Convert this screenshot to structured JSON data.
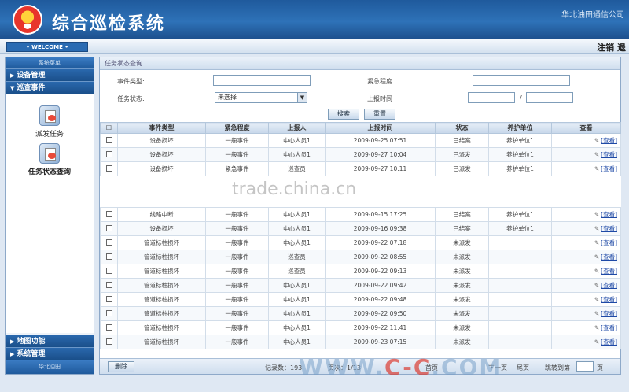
{
  "app": {
    "title": "综合巡检系统",
    "company": "华北油田通信公司",
    "welcome": "• WELCOME •",
    "logout": "注销 退"
  },
  "sidebar": {
    "head": "系统菜单",
    "items": [
      {
        "label": "设备管理"
      },
      {
        "label": "巡查事件"
      }
    ],
    "tasks": [
      {
        "label": "派发任务"
      },
      {
        "label": "任务状态查询"
      }
    ],
    "bottom_items": [
      {
        "label": "地图功能"
      },
      {
        "label": "系统管理"
      }
    ],
    "footer": "华北油田"
  },
  "main": {
    "panel_title": "任务状态查询",
    "filter": {
      "event_type_label": "事件类型:",
      "urgency_label": "紧急程度",
      "status_label": "任务状态:",
      "status_value": "未选择",
      "report_time_label": "上报时间",
      "date_sep": "/",
      "search_button": "搜索",
      "reset_button": "重置"
    },
    "columns": [
      "",
      "事件类型",
      "紧急程度",
      "上报人",
      "上报时间",
      "状态",
      "养护单位",
      "查看"
    ],
    "rows_top": [
      {
        "type": "设备损坏",
        "urgency": "一般事件",
        "reporter": "中心人员1",
        "time": "2009-09-25 07:51",
        "status": "已结案",
        "unit": "养护单位1",
        "view": "[查看]"
      },
      {
        "type": "设备损坏",
        "urgency": "一般事件",
        "reporter": "中心人员1",
        "time": "2009-09-27 10:04",
        "status": "已派发",
        "unit": "养护单位1",
        "view": "[查看]"
      },
      {
        "type": "设备损坏",
        "urgency": "紧急事件",
        "reporter": "巡查员",
        "time": "2009-09-27 10:11",
        "status": "已派发",
        "unit": "养护单位1",
        "view": "[查看]"
      }
    ],
    "rows_bottom": [
      {
        "type": "线路中断",
        "urgency": "一般事件",
        "reporter": "中心人员1",
        "time": "2009-09-15 17:25",
        "status": "已结案",
        "unit": "养护单位1",
        "view": "[查看]"
      },
      {
        "type": "设备损坏",
        "urgency": "一般事件",
        "reporter": "中心人员1",
        "time": "2009-09-16 09:38",
        "status": "已结案",
        "unit": "养护单位1",
        "view": "[查看]"
      },
      {
        "type": "管道标桩损坏",
        "urgency": "一般事件",
        "reporter": "中心人员1",
        "time": "2009-09-22 07:18",
        "status": "未派发",
        "unit": "",
        "view": "[查看]"
      },
      {
        "type": "管道标桩损坏",
        "urgency": "一般事件",
        "reporter": "巡查员",
        "time": "2009-09-22 08:55",
        "status": "未派发",
        "unit": "",
        "view": "[查看]"
      },
      {
        "type": "管道标桩损坏",
        "urgency": "一般事件",
        "reporter": "巡查员",
        "time": "2009-09-22 09:13",
        "status": "未派发",
        "unit": "",
        "view": "[查看]"
      },
      {
        "type": "管道标桩损坏",
        "urgency": "一般事件",
        "reporter": "中心人员1",
        "time": "2009-09-22 09:42",
        "status": "未派发",
        "unit": "",
        "view": "[查看]"
      },
      {
        "type": "管道标桩损坏",
        "urgency": "一般事件",
        "reporter": "中心人员1",
        "time": "2009-09-22 09:48",
        "status": "未派发",
        "unit": "",
        "view": "[查看]"
      },
      {
        "type": "管道标桩损坏",
        "urgency": "一般事件",
        "reporter": "中心人员1",
        "time": "2009-09-22 09:50",
        "status": "未派发",
        "unit": "",
        "view": "[查看]"
      },
      {
        "type": "管道标桩损坏",
        "urgency": "一般事件",
        "reporter": "中心人员1",
        "time": "2009-09-22 11:41",
        "status": "未派发",
        "unit": "",
        "view": "[查看]"
      },
      {
        "type": "管道标桩损坏",
        "urgency": "一般事件",
        "reporter": "中心人员1",
        "time": "2009-09-23 07:15",
        "status": "未派发",
        "unit": "",
        "view": "[查看]"
      }
    ],
    "footer": {
      "delete_button": "删除",
      "record_count": "记录数：193",
      "page_info": "页次：1/13",
      "first_page": "首页",
      "next_page": "下一页",
      "last_page": "尾页",
      "jump_label": "跳转到第",
      "go_button": "页"
    }
  },
  "watermarks": {
    "center": "trade.china.cn",
    "bottom_prefix": "WWW.",
    "bottom_mid": "C-C",
    "bottom_suffix": ".COM"
  }
}
